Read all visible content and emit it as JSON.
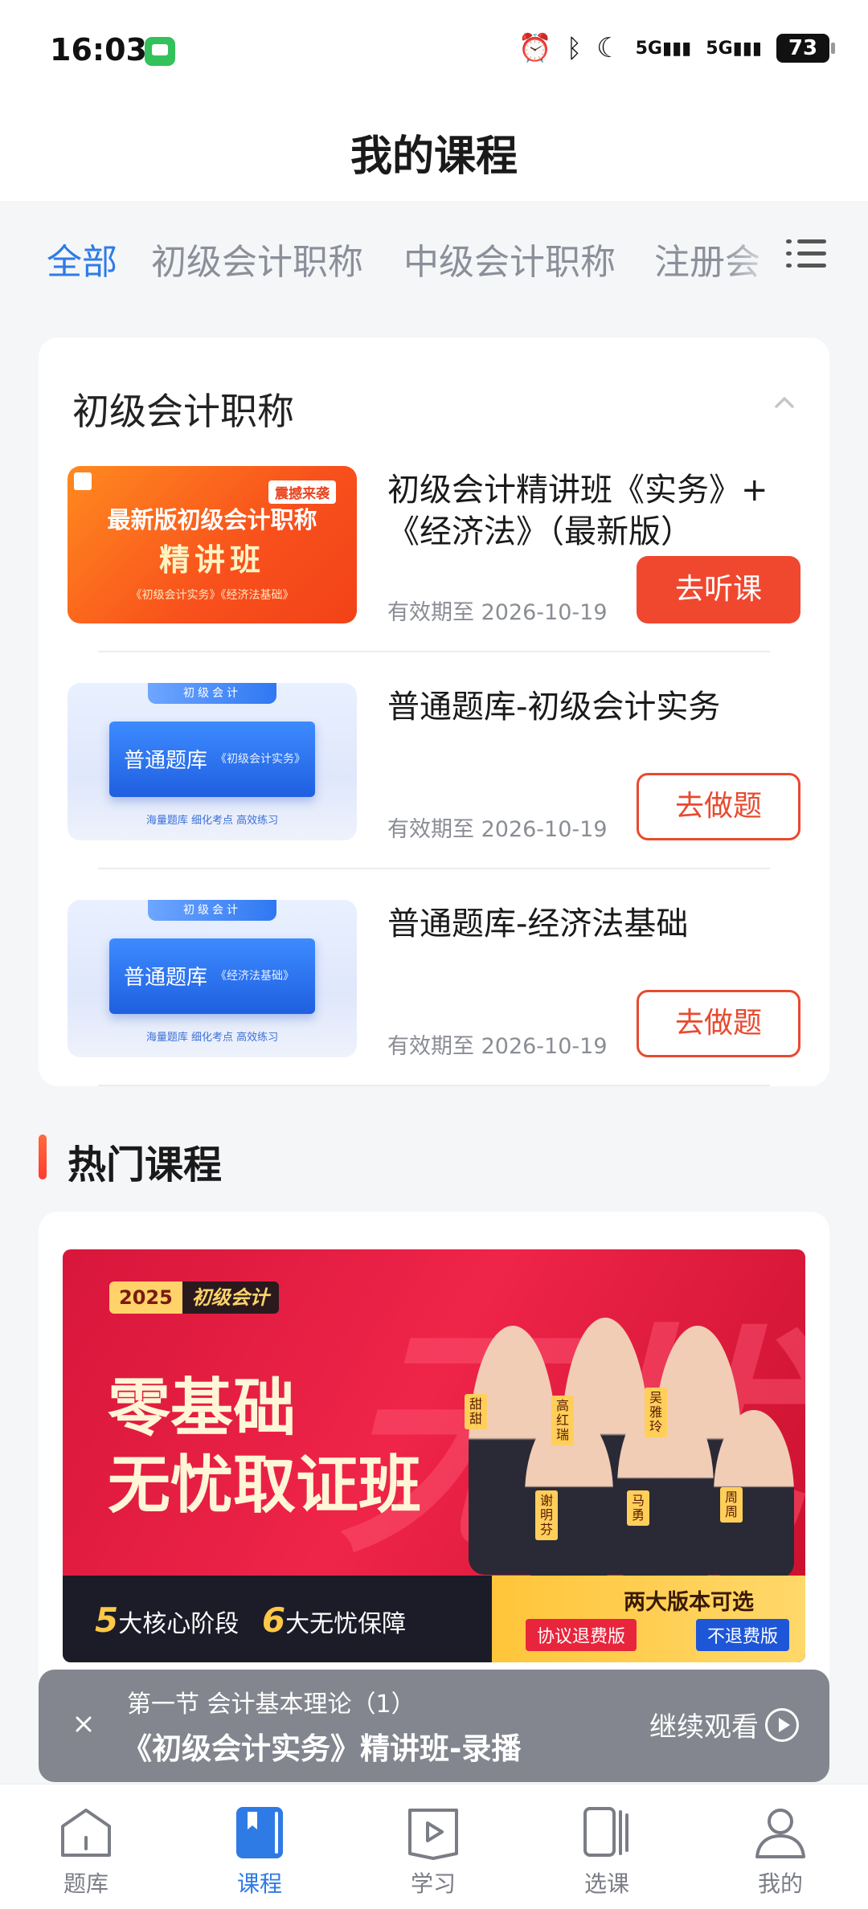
{
  "status_bar": {
    "time": "16:03",
    "battery": "73",
    "signal1": "5G",
    "signal2": "5G"
  },
  "header": {
    "title": "我的课程"
  },
  "tabs": [
    {
      "label": "全部",
      "active": true
    },
    {
      "label": "初级会计职称",
      "active": false
    },
    {
      "label": "中级会计职称",
      "active": false
    },
    {
      "label": "注册会",
      "active": false
    }
  ],
  "course_section": {
    "title": "初级会计职称",
    "items": [
      {
        "name": "初级会计精讲班《实务》+《经济法》（最新版）",
        "expiry": "有效期至 2026-10-19",
        "action": "去听课",
        "thumb": {
          "badge": "震撼来袭",
          "line1": "最新版初级会计职称",
          "line2": "精讲班",
          "line3": "《初级会计实务》《经济法基础》"
        }
      },
      {
        "name": "普通题库-初级会计实务",
        "expiry": "有效期至 2026-10-19",
        "action": "去做题",
        "thumb": {
          "tag": "初级会计",
          "title": "普通题库",
          "sub": "《初级会计实务》",
          "foot": "海量题库  细化考点  高效练习"
        }
      },
      {
        "name": "普通题库-经济法基础",
        "expiry": "有效期至 2026-10-19",
        "action": "去做题",
        "thumb": {
          "tag": "初级会计",
          "title": "普通题库",
          "sub": "《经济法基础》",
          "foot": "海量题库  细化考点  高效练习"
        }
      }
    ]
  },
  "hot": {
    "title": "热门课程",
    "banner": {
      "year": "2025",
      "category": "初级会计",
      "line1": "零基础",
      "line2": "无忧取证班",
      "bg_text": "无忧",
      "foot_num1": "5",
      "foot_text1": "大核心阶段",
      "foot_num2": "6",
      "foot_text2": "大无忧保障",
      "version_title": "两大版本可选",
      "version1": "协议退费版",
      "version2": "不退费版",
      "teachers": [
        "甜甜",
        "高红瑞",
        "吴雅玲",
        "谢明芬",
        "马勇",
        "周周"
      ]
    }
  },
  "continue_bar": {
    "section": "第一节 会计基本理论（1）",
    "title": "《初级会计实务》精讲班-录播",
    "action": "继续观看"
  },
  "bottom_nav": [
    {
      "label": "题库",
      "icon": "question-bank-icon",
      "active": false
    },
    {
      "label": "课程",
      "icon": "course-book-icon",
      "active": true
    },
    {
      "label": "学习",
      "icon": "study-play-icon",
      "active": false
    },
    {
      "label": "选课",
      "icon": "select-course-icon",
      "active": false
    },
    {
      "label": "我的",
      "icon": "profile-icon",
      "active": false
    }
  ],
  "colors": {
    "accent": "#2e7be6",
    "action": "#f0482f",
    "hot_bar": "#ff3b2f"
  }
}
